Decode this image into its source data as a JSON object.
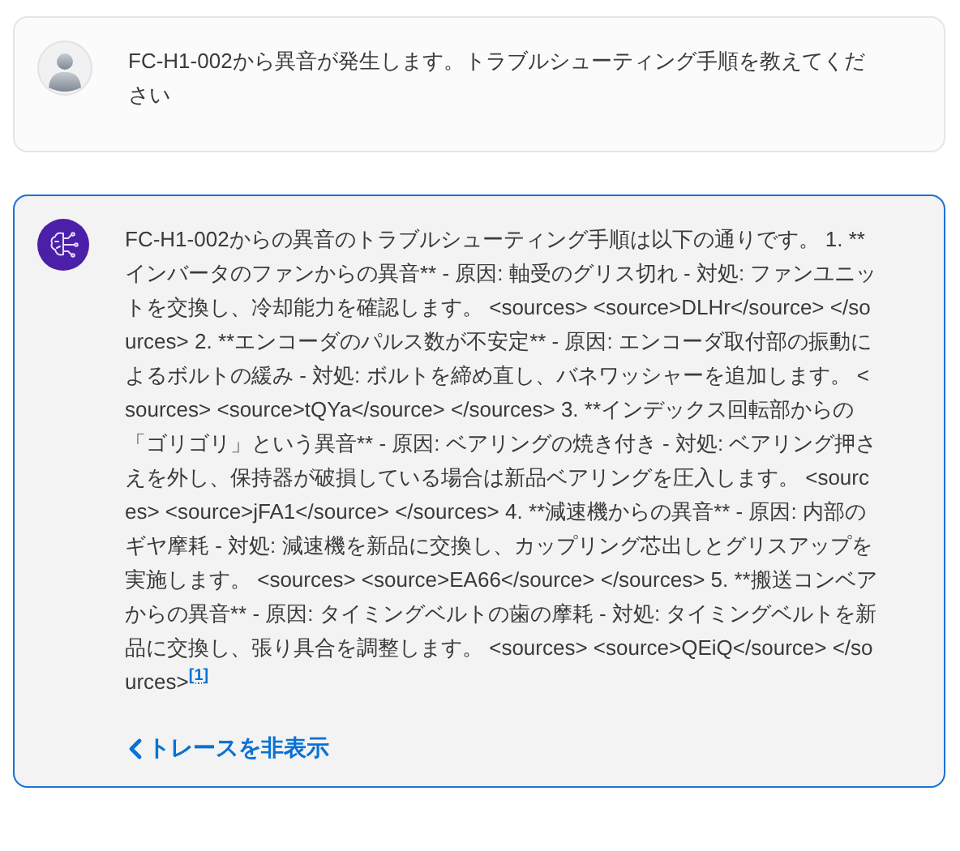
{
  "messages": [
    {
      "kind": "user",
      "text": "FC-H1-002から異音が発生します。トラブルシューティング手順を教えてください"
    },
    {
      "kind": "assistant",
      "text": "FC-H1-002からの異音のトラブルシューティング手順は以下の通りです。 1. **インバータのファンからの異音** - 原因: 軸受のグリス切れ - 対処: ファンユニットを交換し、冷却能力を確認します。 <sources> <source>DLHr</source> </sources> 2. **エンコーダのパルス数が不安定** - 原因: エンコーダ取付部の振動によるボルトの緩み - 対処: ボルトを締め直し、バネワッシャーを追加します。 <sources> <source>tQYa</source> </sources> 3. **インデックス回転部からの「ゴリゴリ」という異音** - 原因: ベアリングの焼き付き - 対処: ベアリング押さえを外し、保持器が破損している場合は新品ベアリングを圧入します。 <sources> <source>jFA1</source> </sources> 4. **減速機からの異音** - 原因: 内部のギヤ摩耗 - 対処: 減速機を新品に交換し、カップリング芯出しとグリスアップを実施します。 <sources> <source>EA66</source> </sources> 5. **搬送コンベアからの異音** - 原因: タイミングベルトの歯の摩耗 - 対処: タイミングベルトを新品に交換し、張り具合を調整します。 <sources> <source>QEiQ</source> </sources>",
      "citation": "[1]",
      "trace_toggle": "トレースを非表示",
      "selected": true
    }
  ]
}
